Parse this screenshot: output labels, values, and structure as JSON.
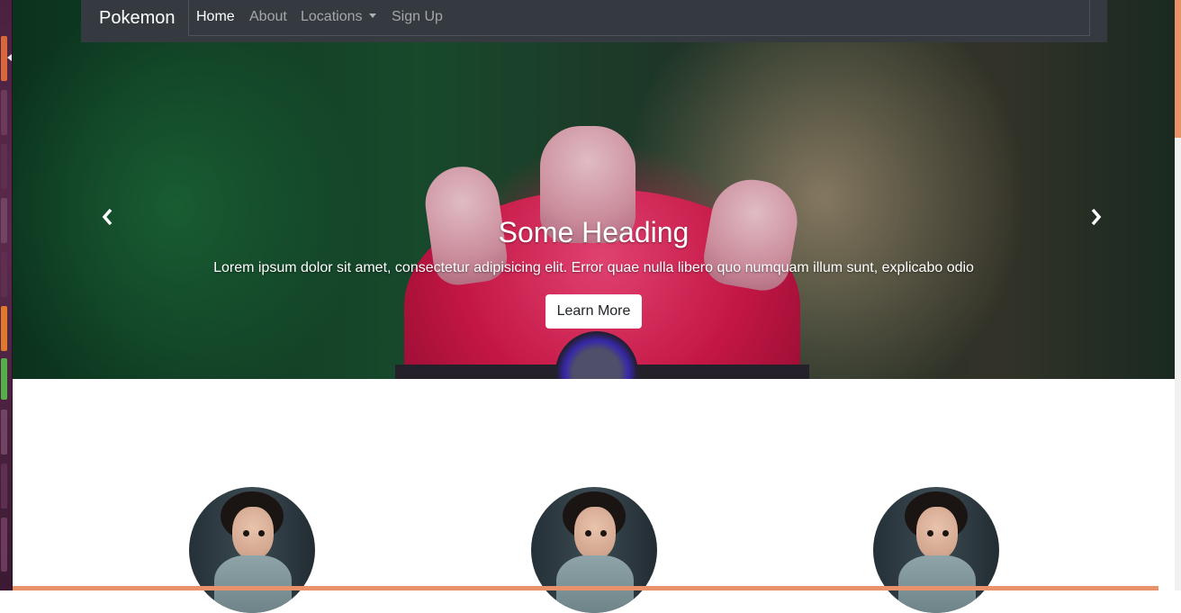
{
  "navbar": {
    "brand": "Pokemon",
    "items": [
      {
        "label": "Home",
        "active": true
      },
      {
        "label": "About",
        "active": false
      },
      {
        "label": "Locations",
        "active": false,
        "dropdown": true
      },
      {
        "label": "Sign Up",
        "active": false
      }
    ]
  },
  "carousel": {
    "heading": "Some Heading",
    "text": "Lorem ipsum dolor sit amet, consectetur adipisicing elit. Error quae nulla libero quo numquam illum sunt, explicabo odio",
    "button_label": "Learn More",
    "prev_icon": "chevron-left-icon",
    "next_icon": "chevron-right-icon"
  },
  "colors": {
    "navbar_bg": "#343a40",
    "accent": "#e9926a"
  }
}
